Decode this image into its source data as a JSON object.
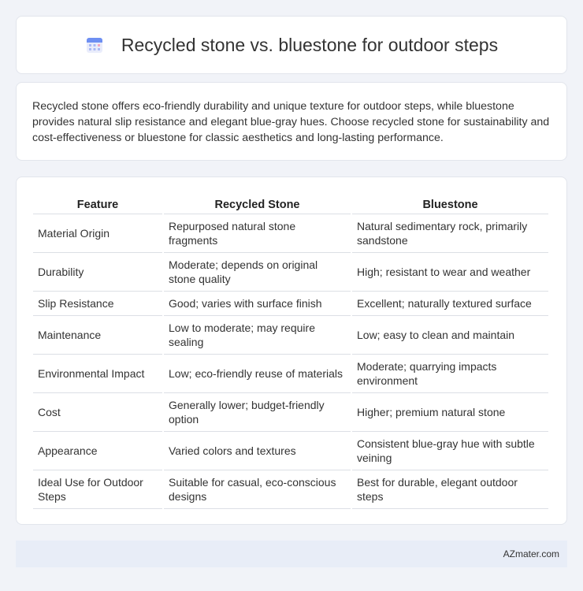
{
  "header": {
    "title": "Recycled stone vs. bluestone for outdoor steps",
    "icon": "calendar-icon"
  },
  "summary": "Recycled stone offers eco-friendly durability and unique texture for outdoor steps, while bluestone provides natural slip resistance and elegant blue-gray hues. Choose recycled stone for sustainability and cost-effectiveness or bluestone for classic aesthetics and long-lasting performance.",
  "table": {
    "headers": [
      "Feature",
      "Recycled Stone",
      "Bluestone"
    ],
    "rows": [
      [
        "Material Origin",
        "Repurposed natural stone fragments",
        "Natural sedimentary rock, primarily sandstone"
      ],
      [
        "Durability",
        "Moderate; depends on original stone quality",
        "High; resistant to wear and weather"
      ],
      [
        "Slip Resistance",
        "Good; varies with surface finish",
        "Excellent; naturally textured surface"
      ],
      [
        "Maintenance",
        "Low to moderate; may require sealing",
        "Low; easy to clean and maintain"
      ],
      [
        "Environmental Impact",
        "Low; eco-friendly reuse of materials",
        "Moderate; quarrying impacts environment"
      ],
      [
        "Cost",
        "Generally lower; budget-friendly option",
        "Higher; premium natural stone"
      ],
      [
        "Appearance",
        "Varied colors and textures",
        "Consistent blue-gray hue with subtle veining"
      ],
      [
        "Ideal Use for Outdoor Steps",
        "Suitable for casual, eco-conscious designs",
        "Best for durable, elegant outdoor steps"
      ]
    ]
  },
  "footer": {
    "text": "AZmater.com"
  }
}
